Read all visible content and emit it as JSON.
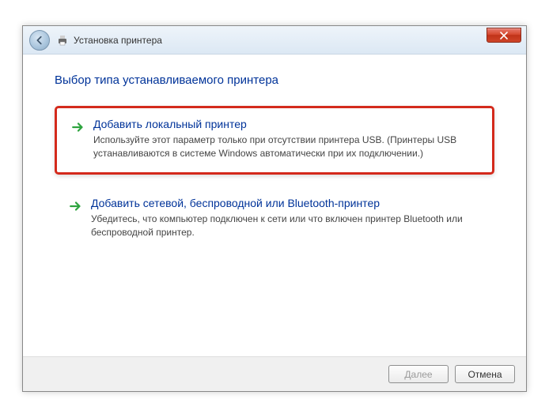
{
  "titlebar": {
    "title": "Установка принтера"
  },
  "heading": "Выбор типа устанавливаемого принтера",
  "options": [
    {
      "title": "Добавить локальный принтер",
      "description": "Используйте этот параметр только при отсутствии принтера USB. (Принтеры USB устанавливаются в системе Windows автоматически при их подключении.)"
    },
    {
      "title": "Добавить сетевой, беспроводной или Bluetooth-принтер",
      "description": "Убедитесь, что компьютер подключен к сети или что включен принтер Bluetooth или беспроводной принтер."
    }
  ],
  "footer": {
    "next": "Далее",
    "cancel": "Отмена"
  }
}
